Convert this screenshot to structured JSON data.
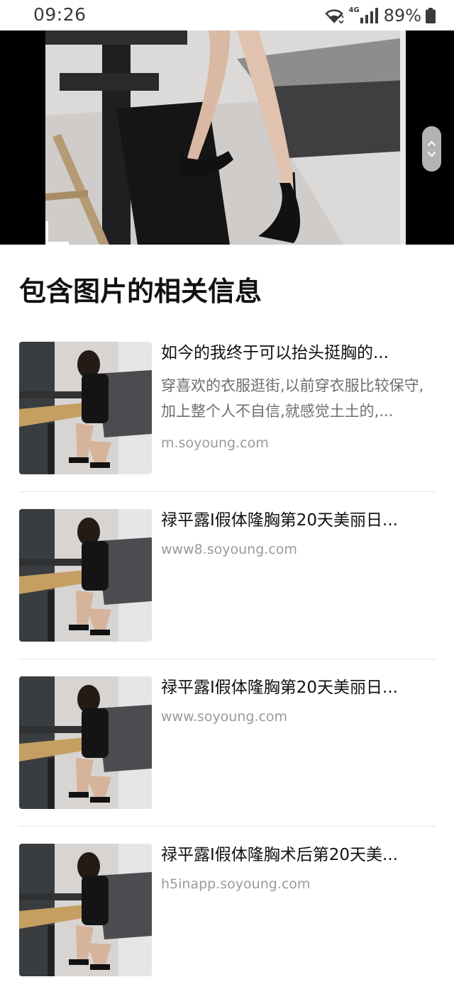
{
  "status_bar": {
    "time": "09:26",
    "network": "4G",
    "battery": "89%"
  },
  "viewer": {
    "photo_label": "seated woman in black heels photo",
    "icons": [
      "chevron-up-icon",
      "chevron-down-icon"
    ]
  },
  "section": {
    "title": "包含图片的相关信息"
  },
  "results": [
    {
      "title": "如今的我终于可以抬头挺胸的...",
      "desc": "穿喜欢的衣服逛街,以前穿衣服比较保守,加上整个人不自信,就感觉土土的,...",
      "source": "m.soyoung.com"
    },
    {
      "title": "禄平露Ⅰ假体隆胸第20天美丽日...",
      "desc": "",
      "source": "www8.soyoung.com"
    },
    {
      "title": "禄平露Ⅰ假体隆胸第20天美丽日...",
      "desc": "",
      "source": "www.soyoung.com"
    },
    {
      "title": "禄平露Ⅰ假体隆胸术后第20天美...",
      "desc": "",
      "source": "h5inapp.soyoung.com"
    }
  ],
  "colors": {
    "text_primary": "#111111",
    "text_secondary": "#6e6e6e",
    "text_source": "#9a9a9a",
    "divider": "#e6e6e6",
    "viewer_bg": "#000000"
  }
}
